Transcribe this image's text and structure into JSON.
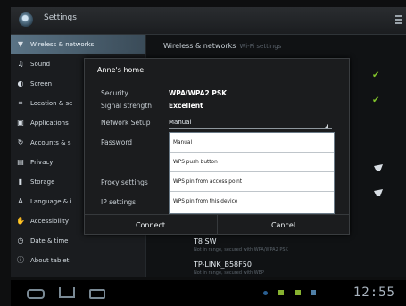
{
  "titlebar": {
    "title": "Settings",
    "app_icon": "settings-icon",
    "menu_icon": "overflow-menu-icon"
  },
  "sidebar": {
    "items": [
      {
        "label": "Wireless & networks",
        "icon": "wireless-icon",
        "glyph": "▼",
        "active": true
      },
      {
        "label": "Sound",
        "icon": "sound-icon",
        "glyph": "♫"
      },
      {
        "label": "Screen",
        "icon": "screen-icon",
        "glyph": "◐"
      },
      {
        "label": "Location & se",
        "icon": "location-icon",
        "glyph": "⌗"
      },
      {
        "label": "Applications",
        "icon": "applications-icon",
        "glyph": "▣"
      },
      {
        "label": "Accounts & s",
        "icon": "accounts-icon",
        "glyph": "↻"
      },
      {
        "label": "Privacy",
        "icon": "privacy-icon",
        "glyph": "▤"
      },
      {
        "label": "Storage",
        "icon": "storage-icon",
        "glyph": "▮"
      },
      {
        "label": "Language & i",
        "icon": "language-icon",
        "glyph": "A"
      },
      {
        "label": "Accessibility",
        "icon": "accessibility-icon",
        "glyph": "✋"
      },
      {
        "label": "Date & time",
        "icon": "date-time-icon",
        "glyph": "◷"
      },
      {
        "label": "About tablet",
        "icon": "about-icon",
        "glyph": "ⓘ"
      }
    ]
  },
  "main": {
    "header": "Wireless & networks",
    "header_sub": "Wi-Fi settings",
    "networks": [
      {
        "name": "T8 SW",
        "status": "Not in range, secured with WPA/WPA2 PSK"
      },
      {
        "name": "TP-LINK_B58F50",
        "status": "Not in range, secured with WEP"
      }
    ]
  },
  "dialog": {
    "title": "Anne's home",
    "fields": [
      {
        "label": "Security",
        "value": "WPA/WPA2 PSK"
      },
      {
        "label": "Signal strength",
        "value": "Excellent"
      },
      {
        "label": "Network Setup",
        "value": "Manual"
      },
      {
        "label": "Password",
        "value": ""
      },
      {
        "label": "Proxy settings",
        "value": ""
      },
      {
        "label": "IP settings",
        "value": ""
      }
    ],
    "dropdown_options": [
      "Manual",
      "WPS push button",
      "WPS pin from access point",
      "WPS pin from this device"
    ],
    "connect_label": "Connect",
    "cancel_label": "Cancel"
  },
  "statusbar": {
    "time": "12:55"
  },
  "colors": {
    "accent": "#6aa0c7",
    "active_item": "#5a7385",
    "check": "#80c22a"
  }
}
